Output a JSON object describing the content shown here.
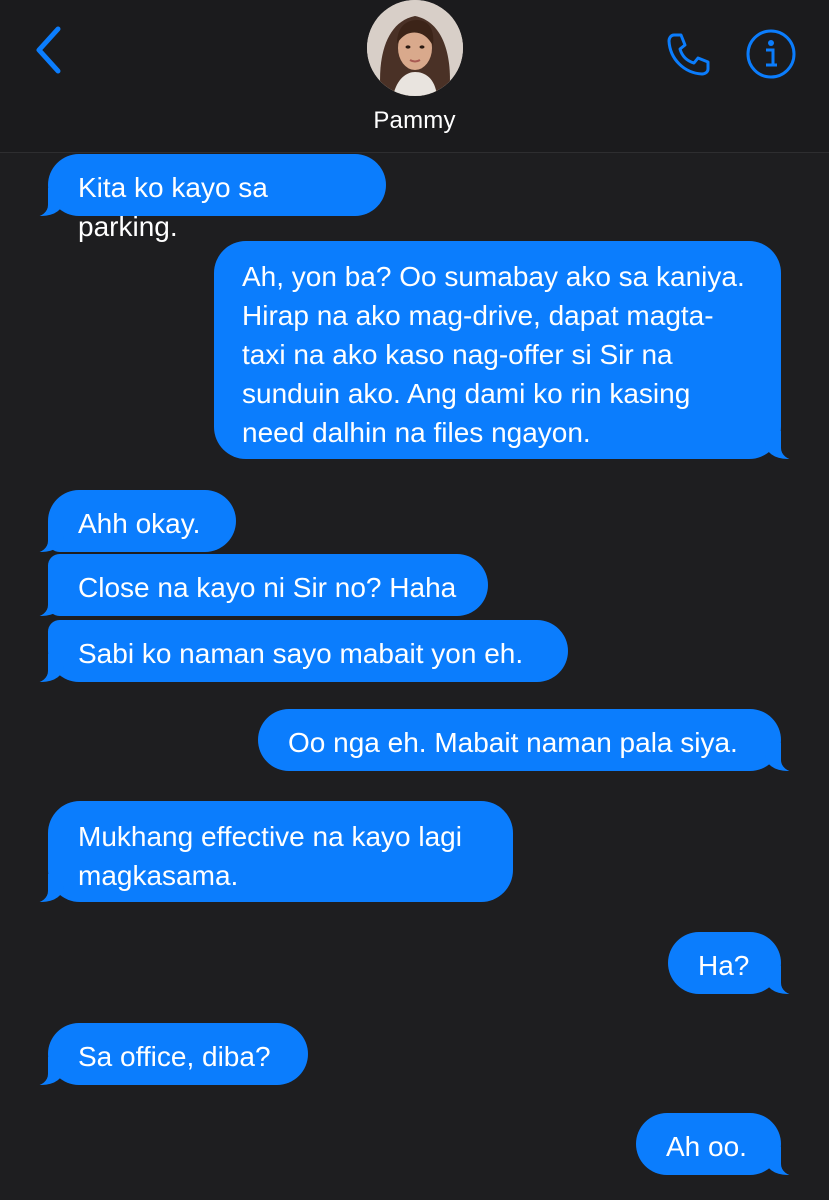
{
  "header": {
    "contact_name": "Pammy",
    "back_icon": "chevron-left-icon",
    "call_icon": "phone-icon",
    "info_icon": "info-icon"
  },
  "colors": {
    "accent": "#0b7dfd",
    "header_bg": "#1b1b1d",
    "chat_bg": "#1e1e20",
    "text": "#ffffff"
  },
  "messages": [
    {
      "side": "received",
      "text": "Kita ko kayo sa parking."
    },
    {
      "side": "sent",
      "text": "Ah, yon ba? Oo sumabay ako sa kaniya. Hirap na ako mag-drive, dapat magta-taxi na ako kaso nag-offer si Sir na sunduin ako. Ang dami ko rin kasing need dalhin na files ngayon."
    },
    {
      "side": "received",
      "text": "Ahh okay."
    },
    {
      "side": "received",
      "text": "Close na kayo ni Sir no? Haha"
    },
    {
      "side": "received",
      "text": "Sabi ko naman sayo mabait yon eh."
    },
    {
      "side": "sent",
      "text": "Oo nga eh. Mabait naman pala siya."
    },
    {
      "side": "received",
      "text": "Mukhang effective na kayo lagi magkasama."
    },
    {
      "side": "sent",
      "text": "Ha?"
    },
    {
      "side": "received",
      "text": "Sa office, diba?"
    },
    {
      "side": "sent",
      "text": "Ah oo."
    }
  ]
}
